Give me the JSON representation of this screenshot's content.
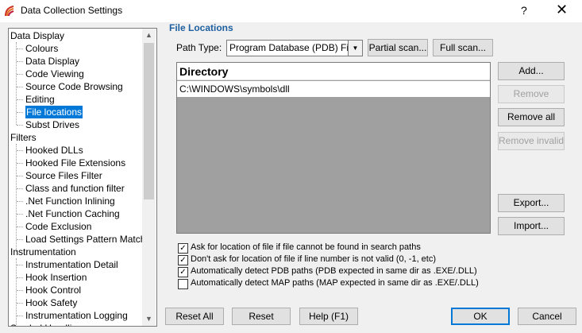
{
  "window": {
    "title": "Data Collection Settings",
    "help": "?",
    "close": "✕"
  },
  "tree": {
    "items": [
      {
        "label": "Data Display",
        "level": 0
      },
      {
        "label": "Colours",
        "level": 1
      },
      {
        "label": "Data Display",
        "level": 1
      },
      {
        "label": "Code Viewing",
        "level": 1
      },
      {
        "label": "Source Code Browsing",
        "level": 1
      },
      {
        "label": "Editing",
        "level": 1
      },
      {
        "label": "File locations",
        "level": 1,
        "selected": true
      },
      {
        "label": "Subst Drives",
        "level": 1
      },
      {
        "label": "Filters",
        "level": 0
      },
      {
        "label": "Hooked DLLs",
        "level": 1
      },
      {
        "label": "Hooked File Extensions",
        "level": 1
      },
      {
        "label": "Source Files Filter",
        "level": 1
      },
      {
        "label": "Class and function filter",
        "level": 1
      },
      {
        "label": ".Net Function Inlining",
        "level": 1
      },
      {
        "label": ".Net Function Caching",
        "level": 1
      },
      {
        "label": "Code Exclusion",
        "level": 1
      },
      {
        "label": "Load Settings Pattern Match",
        "level": 1
      },
      {
        "label": "Instrumentation",
        "level": 0
      },
      {
        "label": "Instrumentation Detail",
        "level": 1
      },
      {
        "label": "Hook Insertion",
        "level": 1
      },
      {
        "label": "Hook Control",
        "level": 1
      },
      {
        "label": "Hook Safety",
        "level": 1
      },
      {
        "label": "Instrumentation Logging",
        "level": 1
      },
      {
        "label": "Symbol Handling",
        "level": 0
      }
    ]
  },
  "panel": {
    "title": "File Locations",
    "path_type_label": "Path Type:",
    "path_type_value": "Program Database (PDB) Files",
    "partial_scan": "Partial scan...",
    "full_scan": "Full scan...",
    "list_header": "Directory",
    "directories": [
      "C:\\WINDOWS\\symbols\\dll"
    ],
    "add": "Add...",
    "remove": "Remove",
    "remove_all": "Remove all",
    "remove_invalid": "Remove invalid",
    "export": "Export...",
    "import": "Import...",
    "options": [
      {
        "label": "Ask for location of file if file cannot be found in search paths",
        "checked": true
      },
      {
        "label": "Don't ask for location of file if line number is not valid (0, -1, etc)",
        "checked": true
      },
      {
        "label": "Automatically detect PDB paths (PDB expected in same dir as .EXE/.DLL)",
        "checked": true
      },
      {
        "label": "Automatically detect MAP paths (MAP expected in same dir as .EXE/.DLL)",
        "checked": false
      }
    ]
  },
  "footer": {
    "reset_all": "Reset All",
    "reset": "Reset",
    "help": "Help (F1)",
    "ok": "OK",
    "cancel": "Cancel"
  }
}
